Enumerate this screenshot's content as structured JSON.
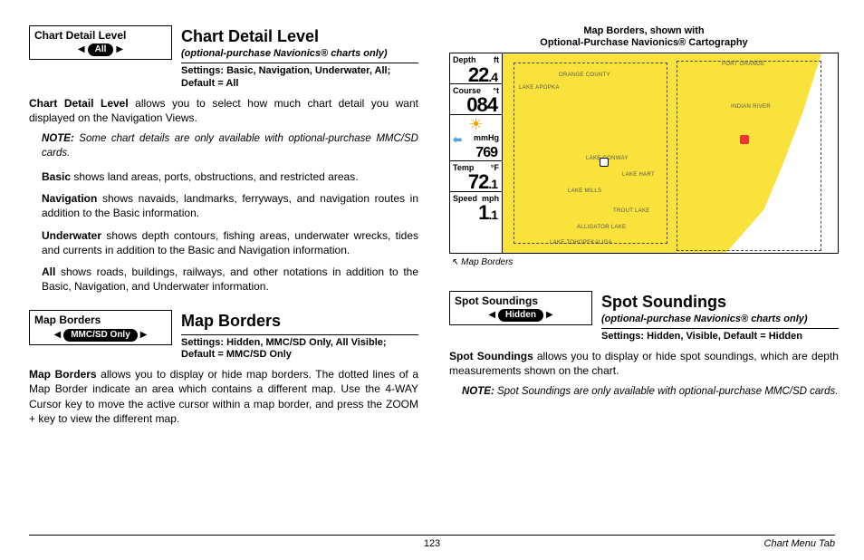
{
  "left": {
    "chartDetail": {
      "widgetTitle": "Chart Detail Level",
      "widgetValue": "All",
      "heading": "Chart Detail Level",
      "sub": "(optional-purchase Navionics® charts only)",
      "settings": "Settings: Basic, Navigation, Underwater, All; Default = All",
      "introBold": "Chart Detail Level",
      "intro": " allows you to select how much chart detail you want displayed on the Navigation Views.",
      "noteLabel": "NOTE:",
      "note": " Some chart details are only available with optional-purchase MMC/SD cards.",
      "basicB": "Basic",
      "basic": " shows land areas, ports, obstructions, and restricted areas.",
      "navB": "Navigation",
      "nav": " shows navaids, landmarks, ferryways, and navigation routes in addition to the Basic information.",
      "uwB": "Underwater",
      "uw": " shows depth contours, fishing areas, underwater wrecks, tides and currents in addition to the Basic and Navigation information.",
      "allB": "All",
      "all": " shows roads, buildings, railways, and other notations in addition to the Basic, Navigation, and Underwater information."
    },
    "mapBorders": {
      "widgetTitle": "Map Borders",
      "widgetValue": "MMC/SD Only",
      "heading": "Map Borders",
      "settings": "Settings: Hidden, MMC/SD Only, All Visible; Default = MMC/SD Only",
      "introBold": "Map Borders",
      "intro": " allows you to display or hide map borders. The dotted lines of a Map Border indicate an area which contains a different map. Use the 4-WAY Cursor key to move the active cursor within a map border, and press the ZOOM + key to view the different map."
    }
  },
  "right": {
    "mapCaption1": "Map Borders, shown with",
    "mapCaption2": "Optional-Purchase Navionics® Cartography",
    "mapBordersLabel": "Map Borders",
    "readouts": {
      "depthLab": "Depth",
      "depthUnit": "ft",
      "depthVal": "22",
      "depthDec": ".4",
      "courseLab": "Course",
      "courseUnit": "°t",
      "courseVal": "084",
      "baroUnit": "mmHg",
      "baroVal": "769",
      "tempLab": "Temp",
      "tempUnit": "°F",
      "tempVal": "72",
      "tempDec": ".1",
      "speedLab": "Speed",
      "speedUnit": "mph",
      "speedVal": "1",
      "speedDec": ".1"
    },
    "mapLabels": [
      "ORANGE COUNTY",
      "LAKE CONWAY",
      "LAKE HART",
      "LAKE MILLS",
      "TROUT LAKE",
      "ALLIGATOR LAKE",
      "LAKE TOHOPEKALIGA",
      "INDIAN RIVER",
      "LAKE APOPKA",
      "PORT ORANGE"
    ],
    "spot": {
      "widgetTitle": "Spot Soundings",
      "widgetValue": "Hidden",
      "heading": "Spot Soundings",
      "sub": "(optional-purchase Navionics® charts only)",
      "settings": "Settings: Hidden, Visible, Default = Hidden",
      "introBold": "Spot Soundings",
      "intro": " allows you to display or hide spot soundings, which are depth measurements shown on the chart.",
      "noteLabel": "NOTE:",
      "note": " Spot Soundings are only available with optional-purchase MMC/SD cards."
    }
  },
  "footer": {
    "page": "123",
    "tab": "Chart Menu Tab"
  }
}
